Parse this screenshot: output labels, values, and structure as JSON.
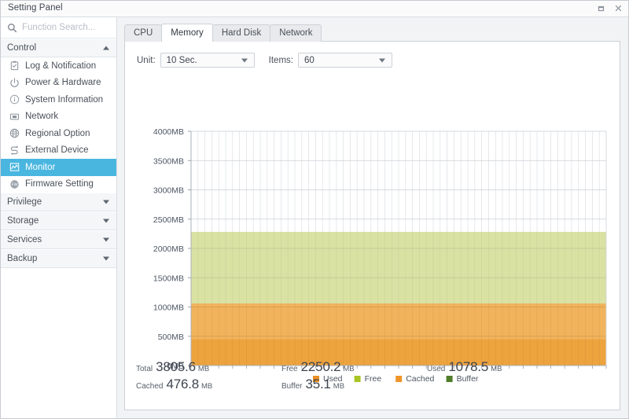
{
  "window": {
    "title": "Setting Panel",
    "buttons": [
      {
        "name": "restore-button",
        "label": "Restore"
      },
      {
        "name": "close-button",
        "label": "Close"
      }
    ]
  },
  "sidebar": {
    "search": {
      "placeholder": "Function Search...",
      "value": "",
      "icon": "search-icon"
    },
    "groups": [
      {
        "label": "Control",
        "expanded": true,
        "caret": "up",
        "items": [
          {
            "label": "Log & Notification",
            "icon": "clipboard-check-icon",
            "active": false
          },
          {
            "label": "Power & Hardware",
            "icon": "power-icon",
            "active": false
          },
          {
            "label": "System Information",
            "icon": "info-circle-icon",
            "active": false
          },
          {
            "label": "Network",
            "icon": "network-card-icon",
            "active": false
          },
          {
            "label": "Regional Option",
            "icon": "globe-icon",
            "active": false
          },
          {
            "label": "External Device",
            "icon": "usb-icon",
            "active": false
          },
          {
            "label": "Monitor",
            "icon": "chart-line-icon",
            "active": true
          },
          {
            "label": "Firmware Setting",
            "icon": "firmware-badge-icon",
            "active": false
          }
        ]
      },
      {
        "label": "Privilege",
        "expanded": false,
        "caret": "down",
        "items": []
      },
      {
        "label": "Storage",
        "expanded": false,
        "caret": "down",
        "items": []
      },
      {
        "label": "Services",
        "expanded": false,
        "caret": "down",
        "items": []
      },
      {
        "label": "Backup",
        "expanded": false,
        "caret": "down",
        "items": []
      }
    ]
  },
  "main": {
    "tabs": [
      {
        "label": "CPU",
        "active": false
      },
      {
        "label": "Memory",
        "active": true
      },
      {
        "label": "Hard Disk",
        "active": false
      },
      {
        "label": "Network",
        "active": false
      }
    ],
    "controls": {
      "unit_label": "Unit:",
      "unit_value": "10 Sec.",
      "items_label": "Items:",
      "items_value": "60"
    },
    "stats": [
      {
        "label": "Total",
        "value": "3805.6",
        "unit": "MB"
      },
      {
        "label": "Free",
        "value": "2250.2",
        "unit": "MB"
      },
      {
        "label": "Used",
        "value": "1078.5",
        "unit": "MB"
      },
      {
        "label": "Cached",
        "value": "476.8",
        "unit": "MB"
      },
      {
        "label": "Buffer",
        "value": "35.1",
        "unit": "MB"
      },
      {
        "label": "",
        "value": "",
        "unit": ""
      }
    ]
  },
  "chart_data": {
    "type": "area",
    "title": "",
    "xlabel": "",
    "ylabel": "",
    "ylim": [
      0,
      4000
    ],
    "yticks": [
      0,
      500,
      1000,
      1500,
      2000,
      2500,
      3000,
      3500,
      4000
    ],
    "ytick_labels": [
      "0MB",
      "500MB",
      "1000MB",
      "1500MB",
      "2000MB",
      "2500MB",
      "3000MB",
      "3500MB",
      "4000MB"
    ],
    "grid": true,
    "legend_position": "bottom",
    "stacked": true,
    "x_count": 60,
    "series": [
      {
        "name": "Used",
        "color": "#eb9b2e",
        "constant_value": 450
      },
      {
        "name": "Cached",
        "color": "#f0ad4e",
        "constant_value": 610
      },
      {
        "name": "Free",
        "color": "#d6de9b",
        "constant_value": 1222
      },
      {
        "name": "Buffer",
        "color": "#4f7d2a",
        "constant_value": 0
      }
    ],
    "legend": [
      {
        "label": "Used",
        "color": "#ed9024"
      },
      {
        "label": "Free",
        "color": "#a9c425"
      },
      {
        "label": "Cached",
        "color": "#f0952a"
      },
      {
        "label": "Buffer",
        "color": "#4f7d2a"
      }
    ]
  }
}
